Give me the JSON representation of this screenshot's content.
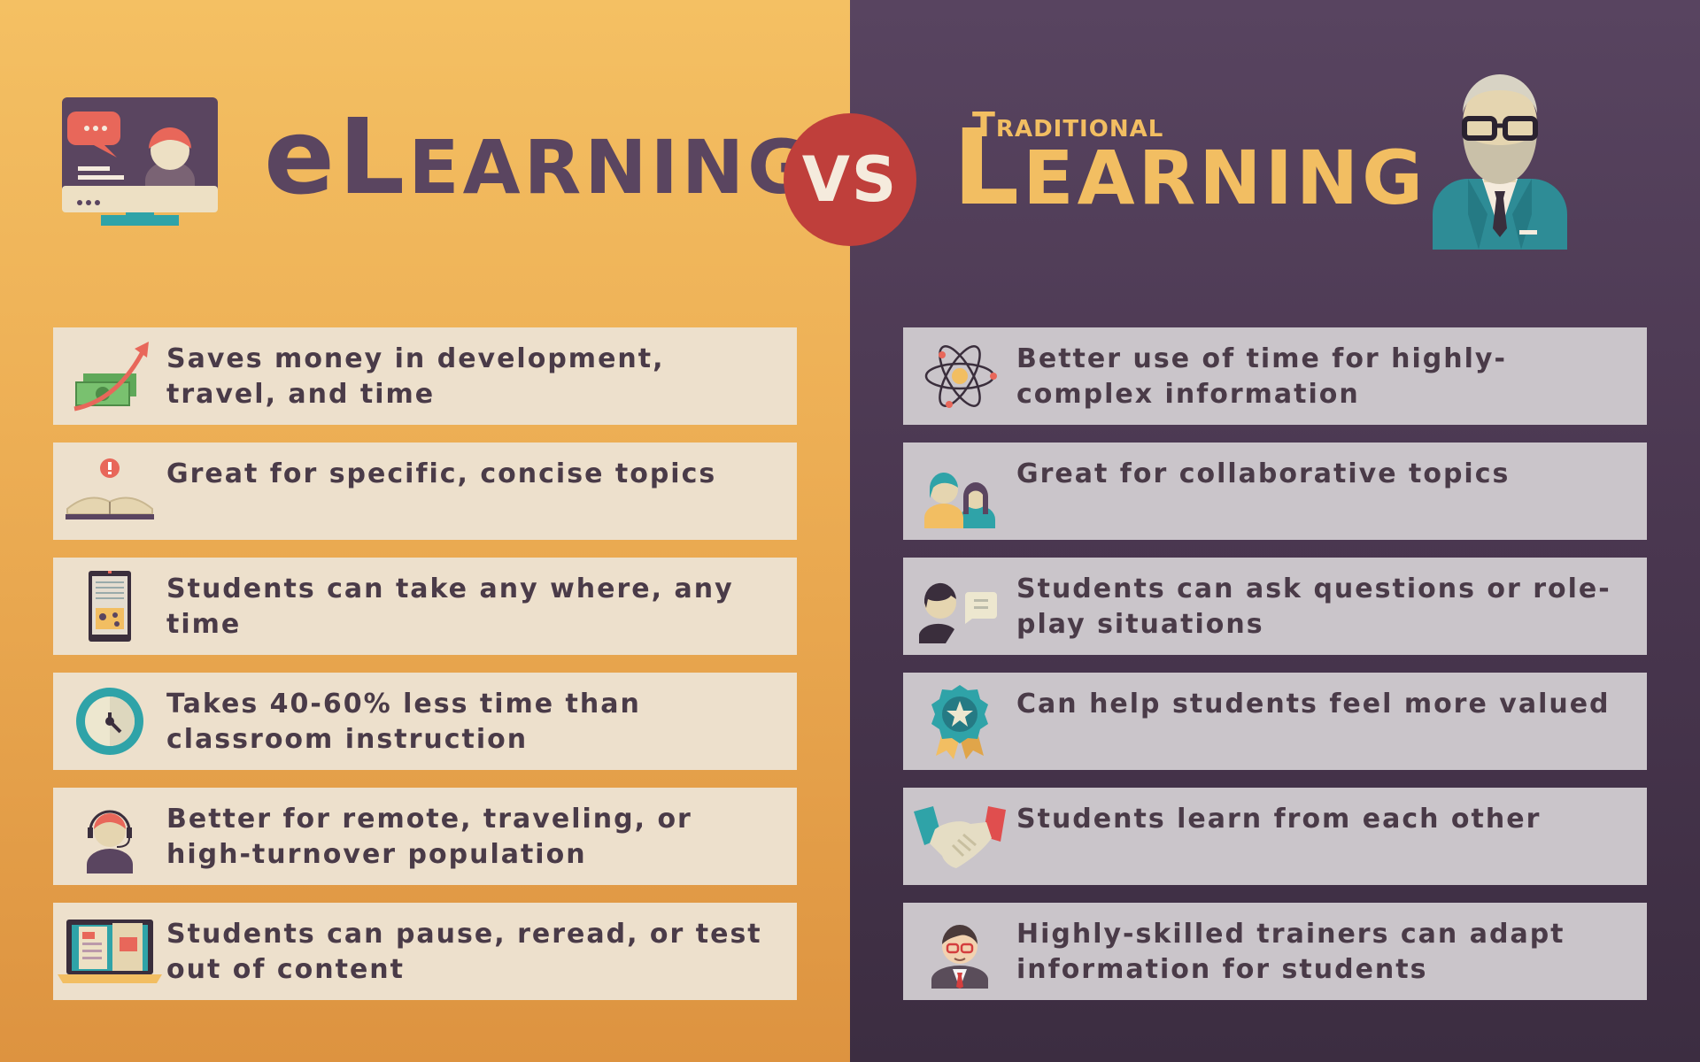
{
  "header": {
    "left_title": {
      "big": "eL",
      "rest": "EARNING"
    },
    "vs": "VS",
    "right_title": {
      "kicker_cap": "T",
      "kicker_rest": "RADITIONAL",
      "big": "L",
      "rest": "EARNING"
    }
  },
  "elearning_items": [
    {
      "text": "Saves money in development, travel, and time",
      "icon": "money-growth-icon"
    },
    {
      "text": "Great for specific, concise topics",
      "icon": "open-book-alert-icon"
    },
    {
      "text": "Students can take any where, any time",
      "icon": "tablet-icon"
    },
    {
      "text": "Takes 40-60% less time than classroom instruction",
      "icon": "clock-icon"
    },
    {
      "text": "Better for remote, traveling, or high-turnover population",
      "icon": "headset-operator-icon"
    },
    {
      "text": "Students can pause, reread, or test out of content",
      "icon": "laptop-content-icon"
    }
  ],
  "traditional_items": [
    {
      "text": "Better use of time for highly-complex information",
      "icon": "atom-icon"
    },
    {
      "text": "Great for collaborative topics",
      "icon": "two-people-icon"
    },
    {
      "text": "Students can ask questions or role-play situations",
      "icon": "person-question-icon"
    },
    {
      "text": "Can help students feel more valued",
      "icon": "award-badge-icon"
    },
    {
      "text": "Students learn from each other",
      "icon": "handshake-icon"
    },
    {
      "text": "Highly-skilled trainers can adapt information for students",
      "icon": "trainer-icon"
    }
  ],
  "colors": {
    "left_bg_top": "#F4C063",
    "left_bg_bottom": "#DD9340",
    "right_bg_top": "#584460",
    "right_bg_bottom": "#3C2D41",
    "vs_circle": "#BF3F3B",
    "title_purple": "#5A4560",
    "title_gold": "#F2BE62",
    "card_left": "#EDE0CC",
    "card_right": "#CAC5CA"
  }
}
